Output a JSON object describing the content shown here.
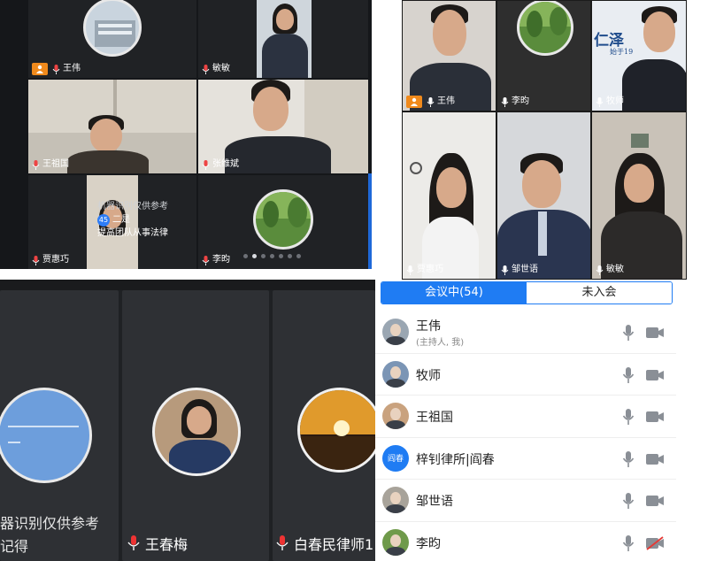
{
  "panel_a": {
    "tiles": [
      {
        "name": "王伟"
      },
      {
        "name": "敏敏"
      },
      {
        "name": "王祖国"
      },
      {
        "name": "张维斌"
      },
      {
        "name": "贾惠巧"
      },
      {
        "name": "李昀"
      }
    ],
    "caption": {
      "label": "机器识别仅供参考",
      "badge": "45",
      "line1": "二是",
      "line2": "提高团队从事法律"
    },
    "pager": {
      "count": 7,
      "active": 1
    }
  },
  "panel_b": {
    "tiles": [
      {
        "name": "王伟"
      },
      {
        "name": "李昀"
      },
      {
        "name": "牧师"
      },
      {
        "name": "贾惠巧"
      },
      {
        "name": "邹世语"
      },
      {
        "name": "敏敏"
      }
    ],
    "wall_text": "仁泽",
    "wall_text_small": "始于19"
  },
  "panel_c": {
    "watermark_line1": "器识别仅供参考",
    "watermark_line2": "记得",
    "tiles": [
      {
        "name": ""
      },
      {
        "name": "王春梅"
      },
      {
        "name": "白春民律师1"
      }
    ]
  },
  "panel_d": {
    "tabs": [
      {
        "label": "会议中(54)"
      },
      {
        "label": "未入会"
      }
    ],
    "participants": [
      {
        "name": "王伟",
        "sub": "(主持人, 我)",
        "cam_off": false
      },
      {
        "name": "牧师",
        "sub": "",
        "cam_off": false
      },
      {
        "name": "王祖国",
        "sub": "",
        "cam_off": false
      },
      {
        "name": "梓钊律所|阎春",
        "avatar_text": "阎春",
        "sub": "",
        "cam_off": false
      },
      {
        "name": "邹世语",
        "sub": "",
        "cam_off": false
      },
      {
        "name": "李昀",
        "sub": "",
        "cam_off": true
      }
    ]
  },
  "colors": {
    "accent_blue": "#1f7cf3",
    "host_orange": "#f08a1c",
    "meeting_dark": "#15171a"
  }
}
